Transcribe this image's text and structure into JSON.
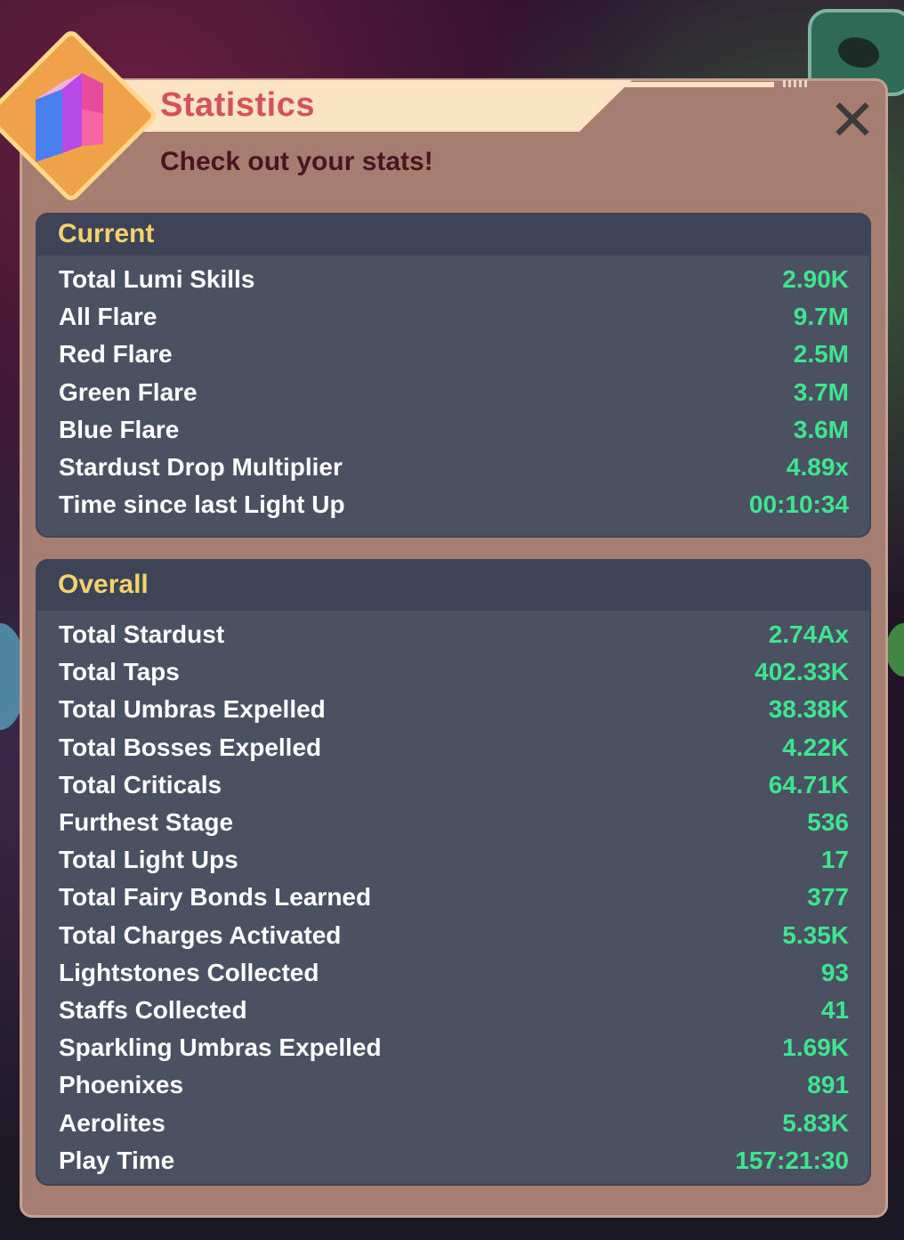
{
  "dialog": {
    "title": "Statistics",
    "subtitle": "Check out your stats!",
    "close_label": "✕"
  },
  "sections": [
    {
      "header": "Current",
      "rows": [
        {
          "label": "Total Lumi Skills",
          "value": "2.90K"
        },
        {
          "label": "All Flare",
          "value": "9.7M"
        },
        {
          "label": "Red Flare",
          "value": "2.5M"
        },
        {
          "label": "Green Flare",
          "value": "3.7M"
        },
        {
          "label": "Blue Flare",
          "value": "3.6M"
        },
        {
          "label": "Stardust Drop Multiplier",
          "value": "4.89x"
        },
        {
          "label": "Time since last Light Up",
          "value": "00:10:34"
        }
      ]
    },
    {
      "header": "Overall",
      "rows": [
        {
          "label": "Total Stardust",
          "value": "2.74Ax"
        },
        {
          "label": "Total Taps",
          "value": "402.33K"
        },
        {
          "label": "Total Umbras Expelled",
          "value": "38.38K"
        },
        {
          "label": "Total Bosses Expelled",
          "value": "4.22K"
        },
        {
          "label": "Total Criticals",
          "value": "64.71K"
        },
        {
          "label": "Furthest Stage",
          "value": "536"
        },
        {
          "label": "Total Light Ups",
          "value": "17"
        },
        {
          "label": "Total Fairy Bonds Learned",
          "value": "377"
        },
        {
          "label": "Total Charges Activated",
          "value": "5.35K"
        },
        {
          "label": "Lightstones Collected",
          "value": "93"
        },
        {
          "label": "Staffs Collected",
          "value": "41"
        },
        {
          "label": "Sparkling Umbras Expelled",
          "value": "1.69K"
        },
        {
          "label": "Phoenixes",
          "value": "891"
        },
        {
          "label": "Aerolites",
          "value": "5.83K"
        },
        {
          "label": "Play Time",
          "value": "157:21:30"
        }
      ]
    }
  ],
  "colors": {
    "title": "#d4525e",
    "subtitle": "#4a1420",
    "section_header": "#f5d36c",
    "value": "#3ee58e",
    "panel": "#a57e70",
    "section_bg": "#4a5163"
  },
  "icons": {
    "dialog_icon": "stats-crystal-icon",
    "close": "close-icon"
  }
}
